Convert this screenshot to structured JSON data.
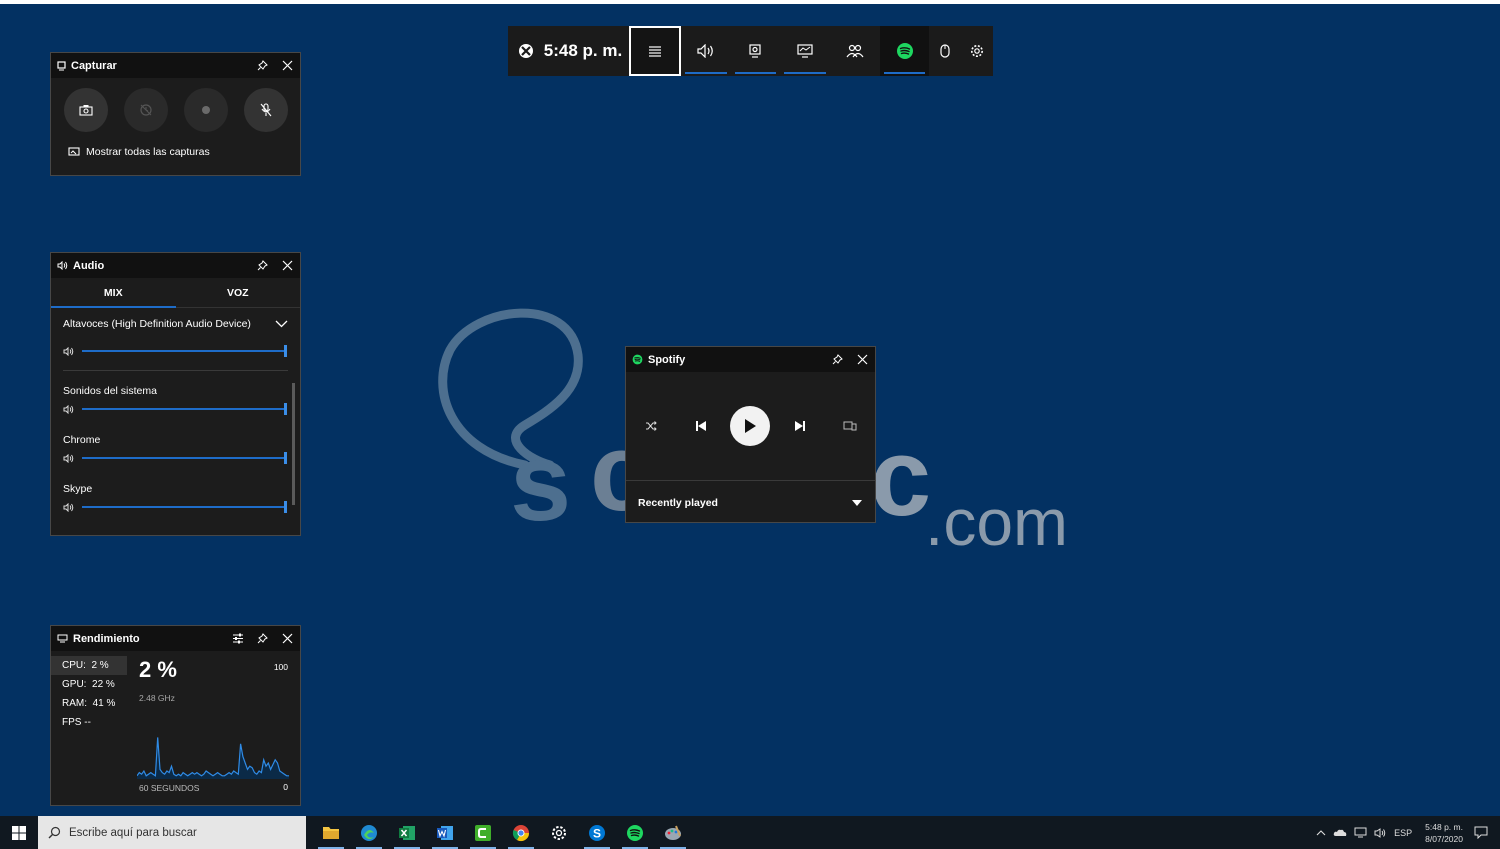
{
  "gamebar": {
    "time": "5:48 p. m.",
    "buttons": [
      "widget-menu",
      "audio",
      "capture",
      "performance",
      "social",
      "spotify",
      "mouse",
      "settings"
    ]
  },
  "capture": {
    "title": "Capturar",
    "show_all_label": "Mostrar todas las capturas"
  },
  "audio": {
    "title": "Audio",
    "tabs": [
      "MIX",
      "VOZ"
    ],
    "selected_tab": "MIX",
    "device": "Altavoces (High Definition Audio Device)",
    "apps": [
      "Sonidos del sistema",
      "Chrome",
      "Skype"
    ],
    "volume_levels": [
      1.0,
      1.0,
      1.0,
      1.0
    ]
  },
  "performance": {
    "title": "Rendimiento",
    "items": [
      {
        "label": "CPU:",
        "value": "2 %"
      },
      {
        "label": "GPU:",
        "value": "22 %"
      },
      {
        "label": "RAM:",
        "value": "41 %"
      },
      {
        "label": "FPS",
        "value": "--"
      }
    ],
    "big_value": "2 %",
    "clock": "2.48 GHz",
    "max_label": "100",
    "min_label": "0",
    "time_window": "60 SEGUNDOS",
    "graph_values": [
      2,
      4,
      3,
      5,
      2,
      3,
      4,
      3,
      2,
      26,
      6,
      4,
      3,
      5,
      4,
      8,
      3,
      2,
      3,
      2,
      4,
      3,
      2,
      3,
      4,
      3,
      4,
      3,
      2,
      3,
      5,
      4,
      3,
      2,
      3,
      4,
      3,
      2,
      2,
      3,
      4,
      3,
      5,
      4,
      3,
      22,
      14,
      10,
      6,
      8,
      7,
      4,
      3,
      5,
      4,
      12,
      8,
      10,
      6,
      9,
      12,
      10,
      5,
      4,
      3,
      2,
      2
    ]
  },
  "spotify": {
    "title": "Spotify",
    "recent_label": "Recently played"
  },
  "taskbar": {
    "search_placeholder": "Escribe aquí para buscar",
    "apps": [
      "file-explorer",
      "edge",
      "excel",
      "word",
      "camtasia",
      "chrome",
      "settings",
      "skype",
      "spotify",
      "paint"
    ],
    "language": "ESP",
    "time": "5:48 p. m.",
    "date": "8/07/2020"
  },
  "colors": {
    "desktop": "#033162",
    "accent": "#1e6cc8",
    "spotify_green": "#1ed760",
    "widget_bg": "#1c1c1c"
  }
}
